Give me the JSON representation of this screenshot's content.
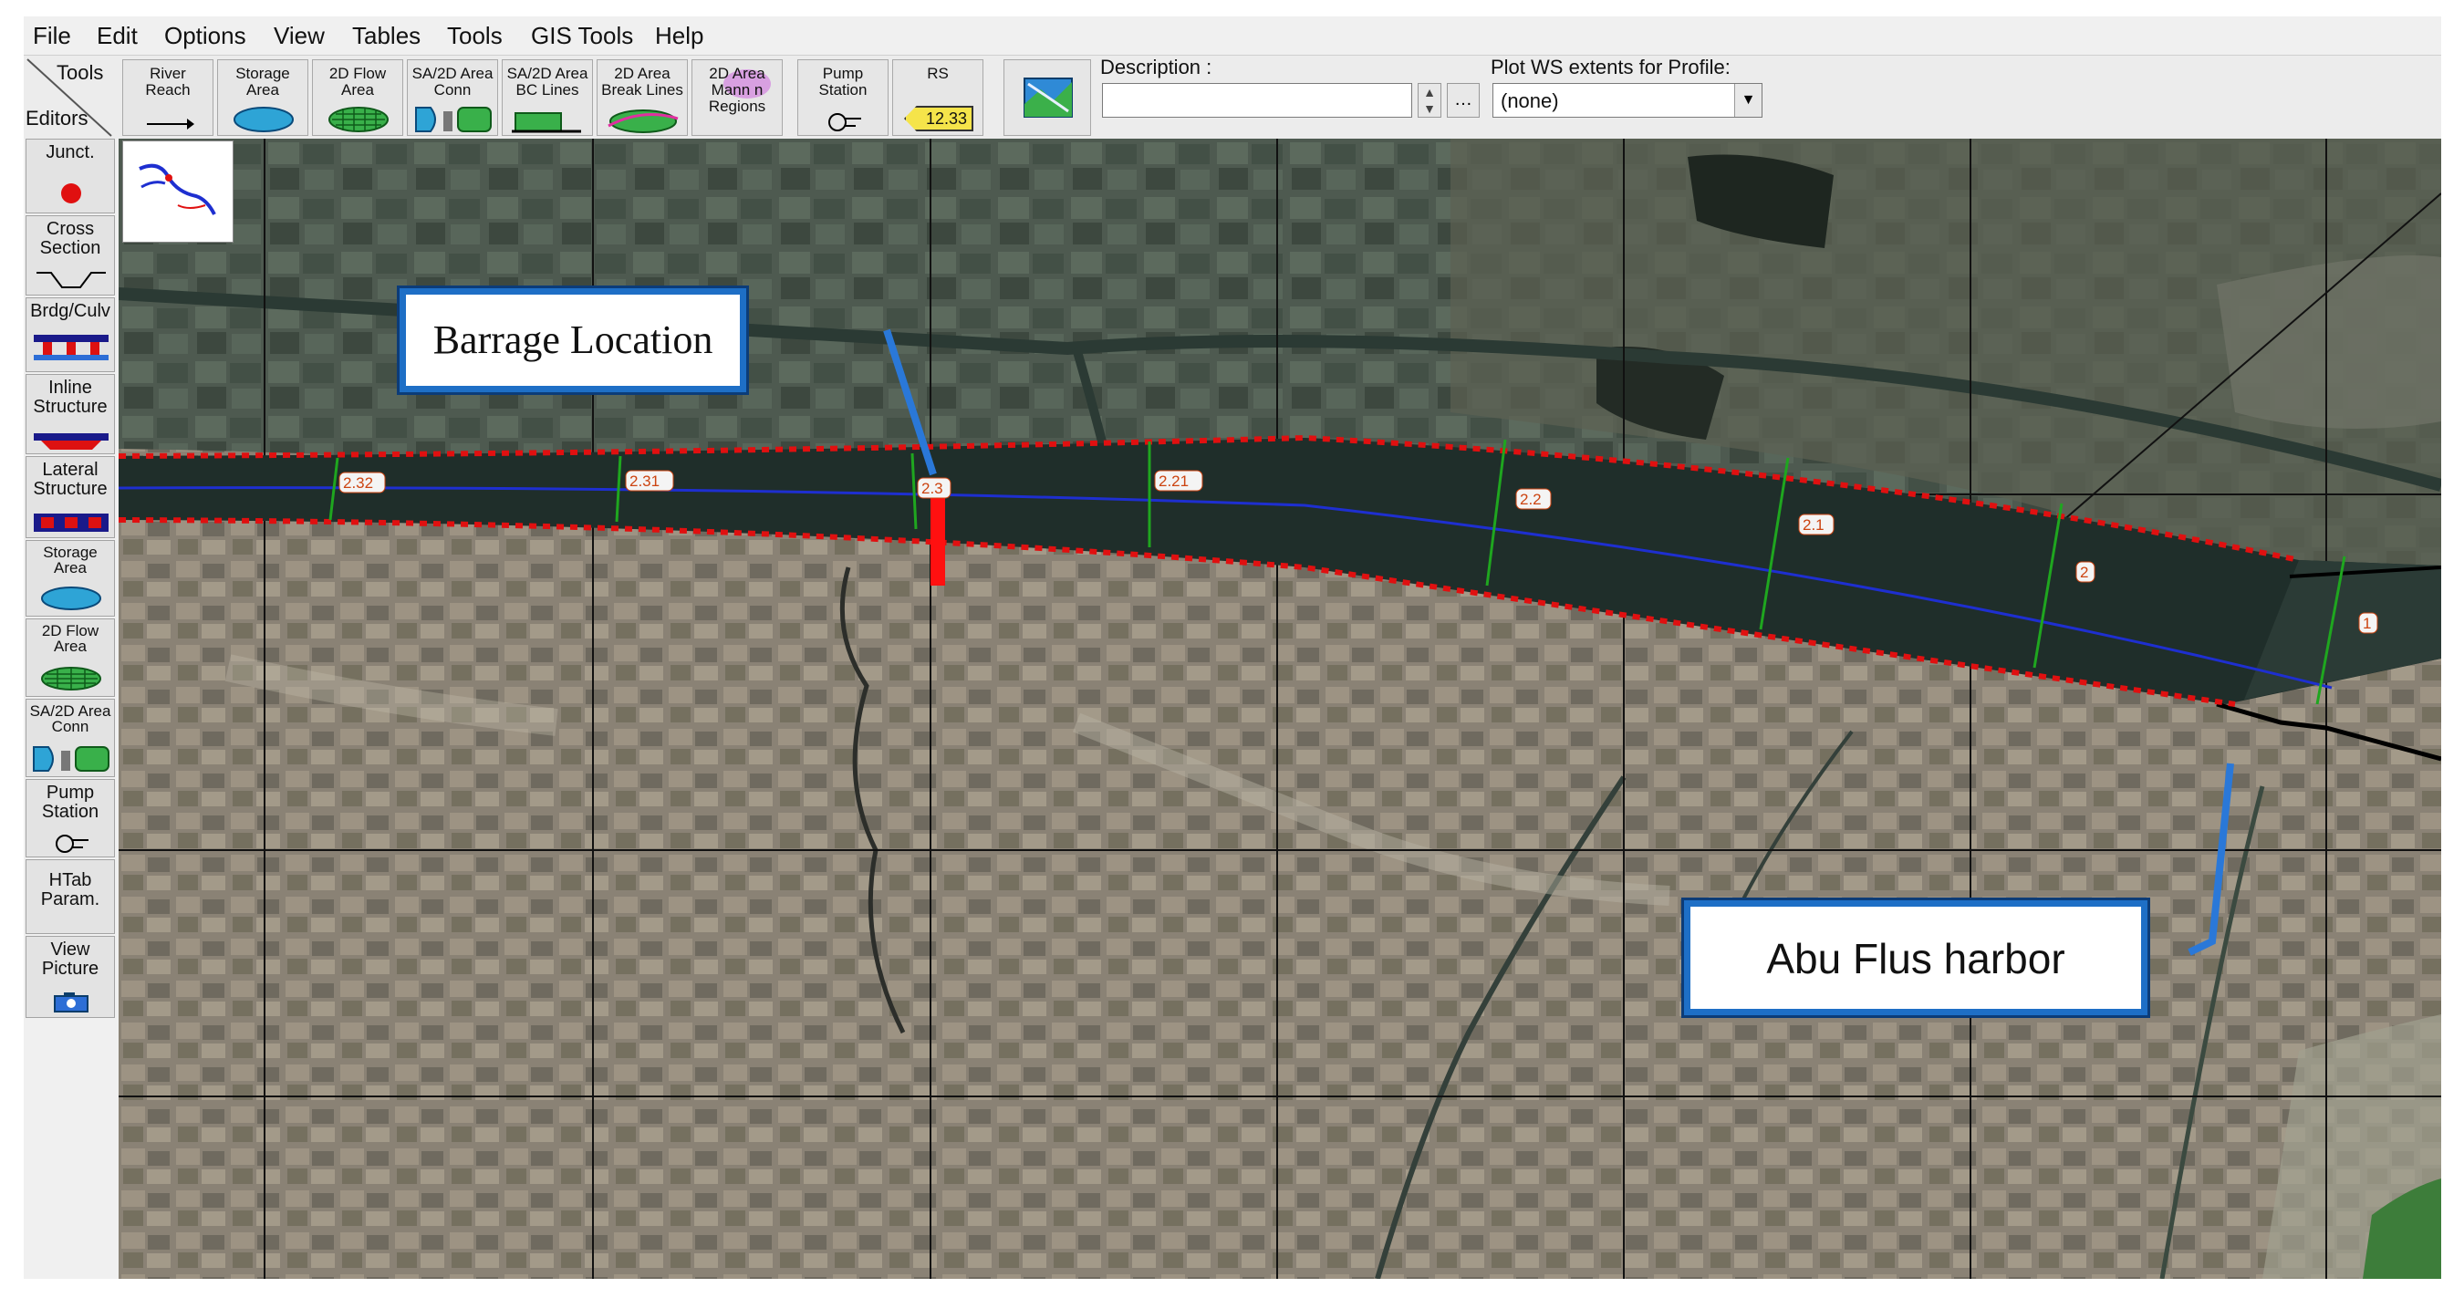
{
  "menu": [
    "File",
    "Edit",
    "Options",
    "View",
    "Tables",
    "Tools",
    "GIS Tools",
    "Help"
  ],
  "tools_label": "Tools",
  "editors_label": "Editors",
  "toolbar_buttons": [
    {
      "id": "river-reach",
      "label": "River\nReach"
    },
    {
      "id": "storage-area",
      "label": "Storage\nArea"
    },
    {
      "id": "2d-flow-area",
      "label": "2D Flow\nArea"
    },
    {
      "id": "sa-2d-conn",
      "label": "SA/2D Area\nConn"
    },
    {
      "id": "sa-2d-bc-lines",
      "label": "SA/2D Area\nBC Lines"
    },
    {
      "id": "2d-break-lines",
      "label": "2D Area\nBreak Lines"
    },
    {
      "id": "2d-mann-regions",
      "label": "2D Area\nMann n\nRegions"
    },
    {
      "id": "pump-station",
      "label": "Pump\nStation"
    },
    {
      "id": "rs",
      "label": "RS"
    }
  ],
  "rs_badge": "12.33",
  "description_label": "Description :",
  "description_value": "",
  "plot_ws_label": "Plot WS extents for Profile:",
  "plot_ws_value": "(none)",
  "sidebar_buttons": [
    {
      "id": "junct",
      "label": "Junct."
    },
    {
      "id": "cross-section",
      "label": "Cross\nSection"
    },
    {
      "id": "brdg-culv",
      "label": "Brdg/Culv"
    },
    {
      "id": "inline-structure",
      "label": "Inline\nStructure"
    },
    {
      "id": "lateral-structure",
      "label": "Lateral\nStructure"
    },
    {
      "id": "storage-area",
      "label": "Storage\nArea"
    },
    {
      "id": "2d-flow-area",
      "label": "2D Flow\nArea"
    },
    {
      "id": "sa-2d-conn",
      "label": "SA/2D Area\nConn"
    },
    {
      "id": "pump-station",
      "label": "Pump\nStation"
    },
    {
      "id": "htab-param",
      "label": "HTab\nParam."
    },
    {
      "id": "view-picture",
      "label": "View\nPicture"
    }
  ],
  "map": {
    "callouts": {
      "barrage": "Barrage Location",
      "harbor": "Abu Flus harbor"
    },
    "cross_section_labels": [
      "2.32",
      "2.31",
      "2.3",
      "2.21",
      "2.2",
      "2.1",
      "2",
      "1"
    ],
    "colors": {
      "river": "#1f2e2a",
      "centerline": "#1e2fd0",
      "boundary": "#e01010",
      "xs": "#1fa61f",
      "barrage": "#ff1010",
      "callout_border": "#1e6fc6",
      "pointer": "#2a78d8"
    }
  }
}
